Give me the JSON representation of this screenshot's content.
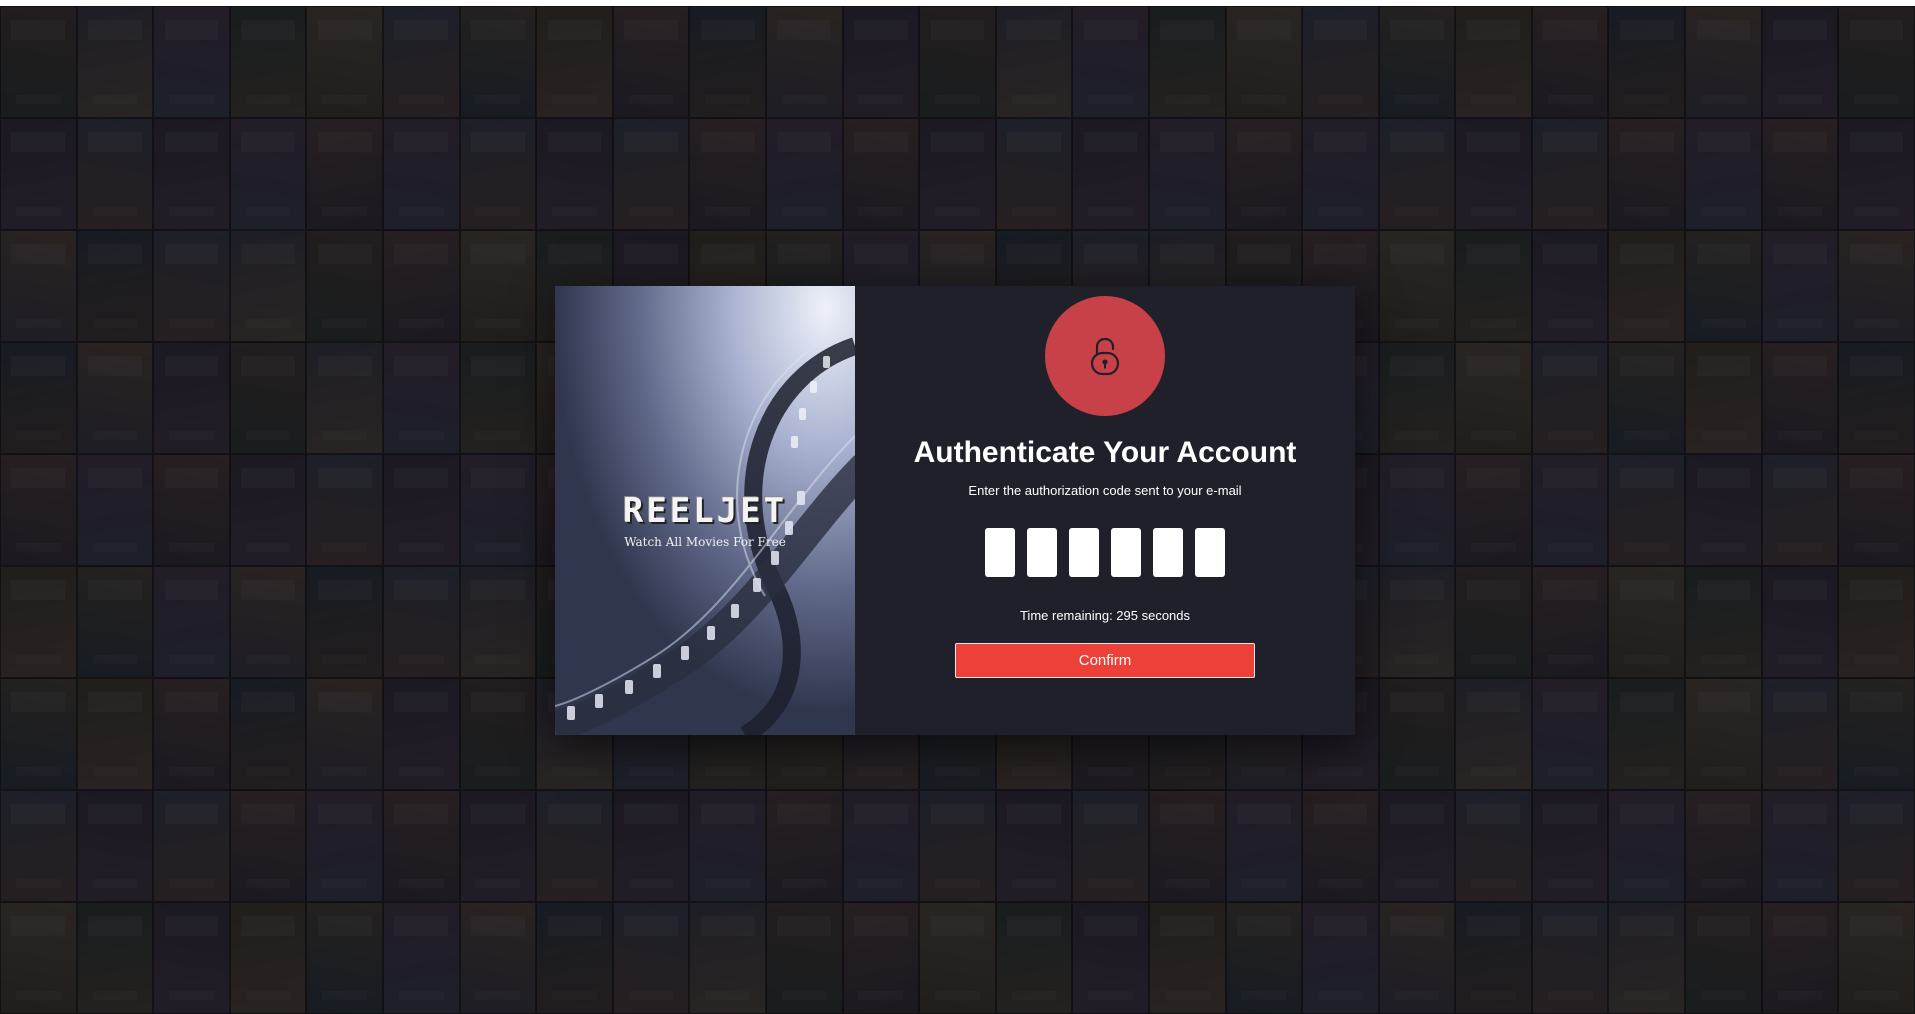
{
  "colors": {
    "backdrop": "#1a1a20",
    "panel": "#20202b",
    "lock_circle": "#c94148",
    "lock_icon": "#20202b",
    "confirm_button": "#ec4038",
    "text": "#ffffff"
  },
  "background": {
    "description": "tiled movie poster wall",
    "poster_palette": [
      "#4a3c32",
      "#3a4150",
      "#5a4a3a",
      "#2f3a34",
      "#55403a",
      "#3c3c48",
      "#4e4636",
      "#36303c",
      "#5c5040",
      "#2a3640",
      "#4a3a4a",
      "#443c2c"
    ]
  },
  "brand": {
    "logo": "REELJET",
    "tagline": "Watch All Movies For Free",
    "image": "film-reel"
  },
  "auth": {
    "icon": "lock-icon",
    "title": "Authenticate Your Account",
    "subtitle": "Enter the authorization code sent to your e-mail",
    "code_digits": [
      "",
      "",
      "",
      "",
      "",
      ""
    ],
    "timer_text": "Time remaining: 295 seconds",
    "confirm_label": "Confirm"
  }
}
